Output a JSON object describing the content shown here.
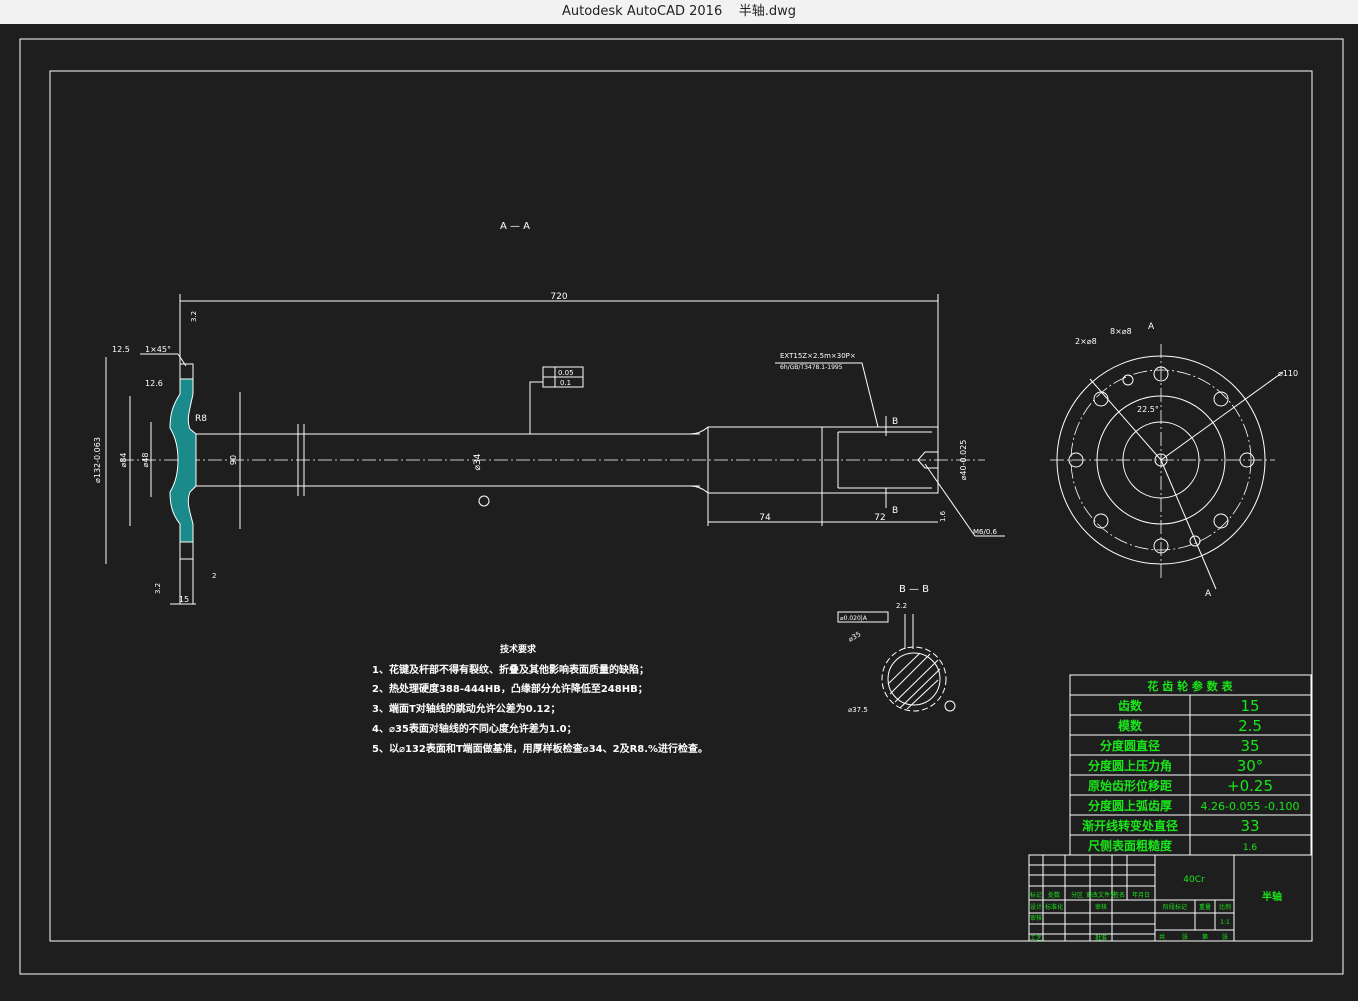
{
  "window": {
    "app": "Autodesk AutoCAD 2016",
    "file": "半轴.dwg"
  },
  "drawing": {
    "view_aa": "A — A",
    "view_bb": "B — B",
    "section_mark_a": "A",
    "section_mark_b": "B",
    "dims": {
      "total_length": "720",
      "d34": "⌀34",
      "d40": "⌀40-0.025",
      "len74": "74",
      "len72": "72",
      "r8": "R8",
      "d84": "⌀84",
      "d48": "⌀48",
      "d132": "⌀132-0.063",
      "d90": "90",
      "flange_15": "15",
      "flange_2": "2",
      "chamfer": "1×45°",
      "rough_125": "12.5",
      "rough_126": "12.6",
      "rough_32": "3.2",
      "rough_16": "1.6",
      "tol_1": "0.05",
      "tol_2": "0.1",
      "spline_note_1": "EXT15Z×2.5m×30P×",
      "spline_note_2": "6h/GB/T3478.1-1995",
      "m6": "M6/0.6",
      "d110": "⌀110",
      "holes_2": "2×⌀8",
      "holes_8": "8×⌀8",
      "angle": "22.5°",
      "d375": "⌀37.5",
      "d35": "⌀35",
      "bb_box": "⌀0.020|A",
      "bb_22": "2.2"
    }
  },
  "tech_requirements": {
    "title": "技术要求",
    "items": [
      "1、花键及杆部不得有裂纹、折叠及其他影响表面质量的缺陷；",
      "2、热处理硬度388-444HB，凸缘部分允许降低至248HB；",
      "3、端面T对轴线的跳动允许公差为0.12；",
      "4、⌀35表面对轴线的不同心度允许差为1.0；",
      "5、以⌀132表面和T端面做基准，用厚样板检查⌀34、2及R8.%进行检查。"
    ]
  },
  "spline_table": {
    "title": "花 齿 轮 参 数 表",
    "rows": [
      {
        "label": "齿数",
        "value": "15"
      },
      {
        "label": "模数",
        "value": "2.5"
      },
      {
        "label": "分度圆直径",
        "value": "35"
      },
      {
        "label": "分度圆上压力角",
        "value": "30°"
      },
      {
        "label": "原始齿形位移距",
        "value": "+0.25"
      },
      {
        "label": "分度圆上弧齿厚",
        "value": "4.26-0.055 -0.100"
      },
      {
        "label": "渐开线转变处直径",
        "value": "33"
      },
      {
        "label": "尺侧表面粗糙度",
        "value": "1.6"
      }
    ]
  },
  "title_block": {
    "material": "40Cr",
    "part_name": "半轴",
    "scale": "1:1",
    "labels": [
      "标记",
      "处数",
      "分区",
      "更改文件号",
      "签名",
      "年月日",
      "设计",
      "标准化",
      "阶段标记",
      "重量",
      "比例",
      "审核",
      "工艺",
      "批准",
      "共",
      "张",
      "第",
      "张"
    ]
  },
  "colors": {
    "background": "#1e1e1e",
    "lines": "#ffffff",
    "table_text": "#19e619",
    "hatch_fill": "#1a8a8a"
  }
}
